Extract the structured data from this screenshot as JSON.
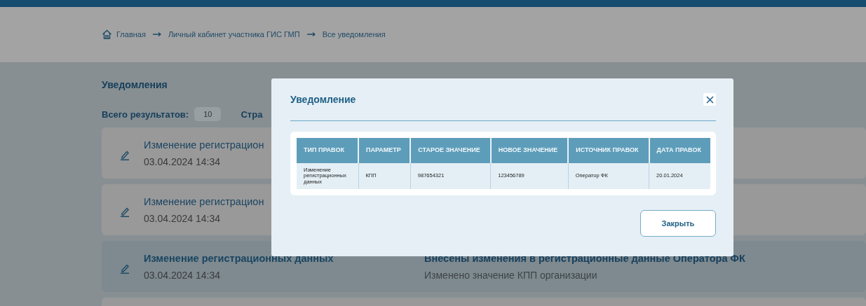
{
  "breadcrumb": [
    {
      "label": "Главная",
      "kind": "home"
    },
    {
      "label": "Личный кабинет участника ГИС ГМП",
      "kind": "link"
    },
    {
      "label": "Все уведомления",
      "kind": "link"
    }
  ],
  "page_title": "Уведомления",
  "results": {
    "label": "Всего результатов:",
    "value": "10"
  },
  "pages_label": "Стра",
  "notifications": [
    {
      "title": "Изменение регистрацион",
      "date": "03.04.2024 14:34",
      "selected": false
    },
    {
      "title": "Изменение регистрацион",
      "date": "03.04.2024 14:34",
      "selected": false
    },
    {
      "title": "Изменение регистрационных данных",
      "date": "03.04.2024 14:34",
      "message_title": "Внесены изменения в регистрационные данные Оператора ФК",
      "message": "Изменено значение КПП организации",
      "selected": true
    },
    {
      "selected": false
    }
  ],
  "modal": {
    "title": "Уведомление",
    "columns": [
      "ТИП ПРАВОК",
      "ПАРАМЕТР",
      "СТАРОЕ ЗНАЧЕНИЕ",
      "НОВОЕ ЗНАЧЕНИЕ",
      "ИСТОЧНИК ПРАВОК",
      "ДАТА ПРАВОК"
    ],
    "rows": [
      [
        "Изменение регистрационных данных",
        "КПП",
        "987654321",
        "123456789",
        "Оператор ФК",
        "20.01.2024"
      ]
    ],
    "close_button": "Закрыть"
  }
}
